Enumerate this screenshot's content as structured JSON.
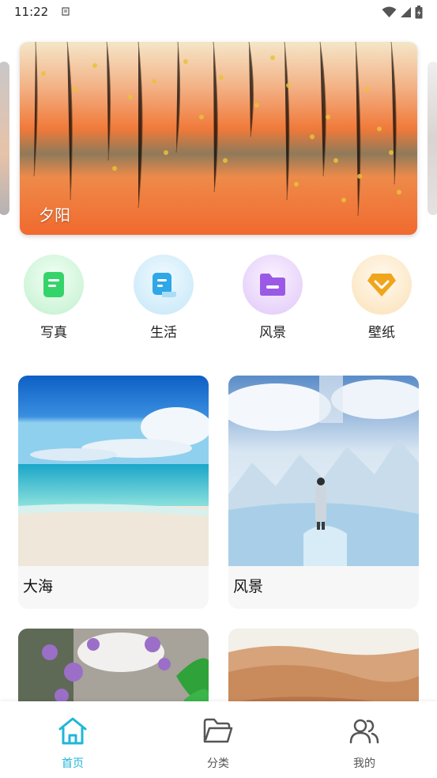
{
  "status": {
    "time": "11:22"
  },
  "banner": {
    "title": "夕阳"
  },
  "categories": [
    {
      "label": "写真",
      "icon": "document-icon",
      "color": "#35d46a"
    },
    {
      "label": "生活",
      "icon": "scroll-icon",
      "color": "#2fa7e8"
    },
    {
      "label": "风景",
      "icon": "folder-icon",
      "color": "#9a5ae6"
    },
    {
      "label": "壁纸",
      "icon": "diamond-icon",
      "color": "#f1a51c"
    }
  ],
  "cards": [
    {
      "title": "大海"
    },
    {
      "title": "风景"
    }
  ],
  "nav": {
    "active_color": "#1fb6d8",
    "items": [
      {
        "label": "首页",
        "icon": "home-icon"
      },
      {
        "label": "分类",
        "icon": "folder-icon"
      },
      {
        "label": "我的",
        "icon": "users-icon"
      }
    ]
  }
}
